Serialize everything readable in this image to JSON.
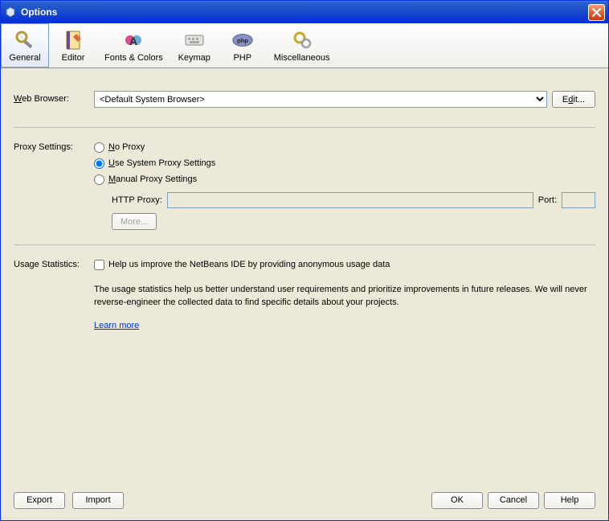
{
  "window": {
    "title": "Options"
  },
  "toolbar": {
    "items": [
      {
        "label": "General",
        "selected": true
      },
      {
        "label": "Editor",
        "selected": false
      },
      {
        "label": "Fonts & Colors",
        "selected": false
      },
      {
        "label": "Keymap",
        "selected": false
      },
      {
        "label": "PHP",
        "selected": false
      },
      {
        "label": "Miscellaneous",
        "selected": false
      }
    ]
  },
  "web_browser": {
    "label": "Web Browser:",
    "value": "<Default System Browser>",
    "edit_label": "Edit..."
  },
  "proxy": {
    "label": "Proxy Settings:",
    "no_proxy": "No Proxy",
    "use_system": "Use System Proxy Settings",
    "manual": "Manual Proxy Settings",
    "selected": "use_system",
    "http_proxy_label": "HTTP Proxy:",
    "http_proxy_value": "",
    "port_label": "Port:",
    "port_value": "",
    "more_label": "More..."
  },
  "usage": {
    "label": "Usage Statistics:",
    "checkbox_label": "Help us improve the NetBeans IDE by providing anonymous usage data",
    "checked": false,
    "description": "The usage statistics help us better understand user requirements and prioritize improvements in future releases. We will never reverse-engineer the collected data to find specific details about your projects.",
    "learn_more": "Learn more"
  },
  "footer": {
    "export": "Export",
    "import": "Import",
    "ok": "OK",
    "cancel": "Cancel",
    "help": "Help"
  }
}
